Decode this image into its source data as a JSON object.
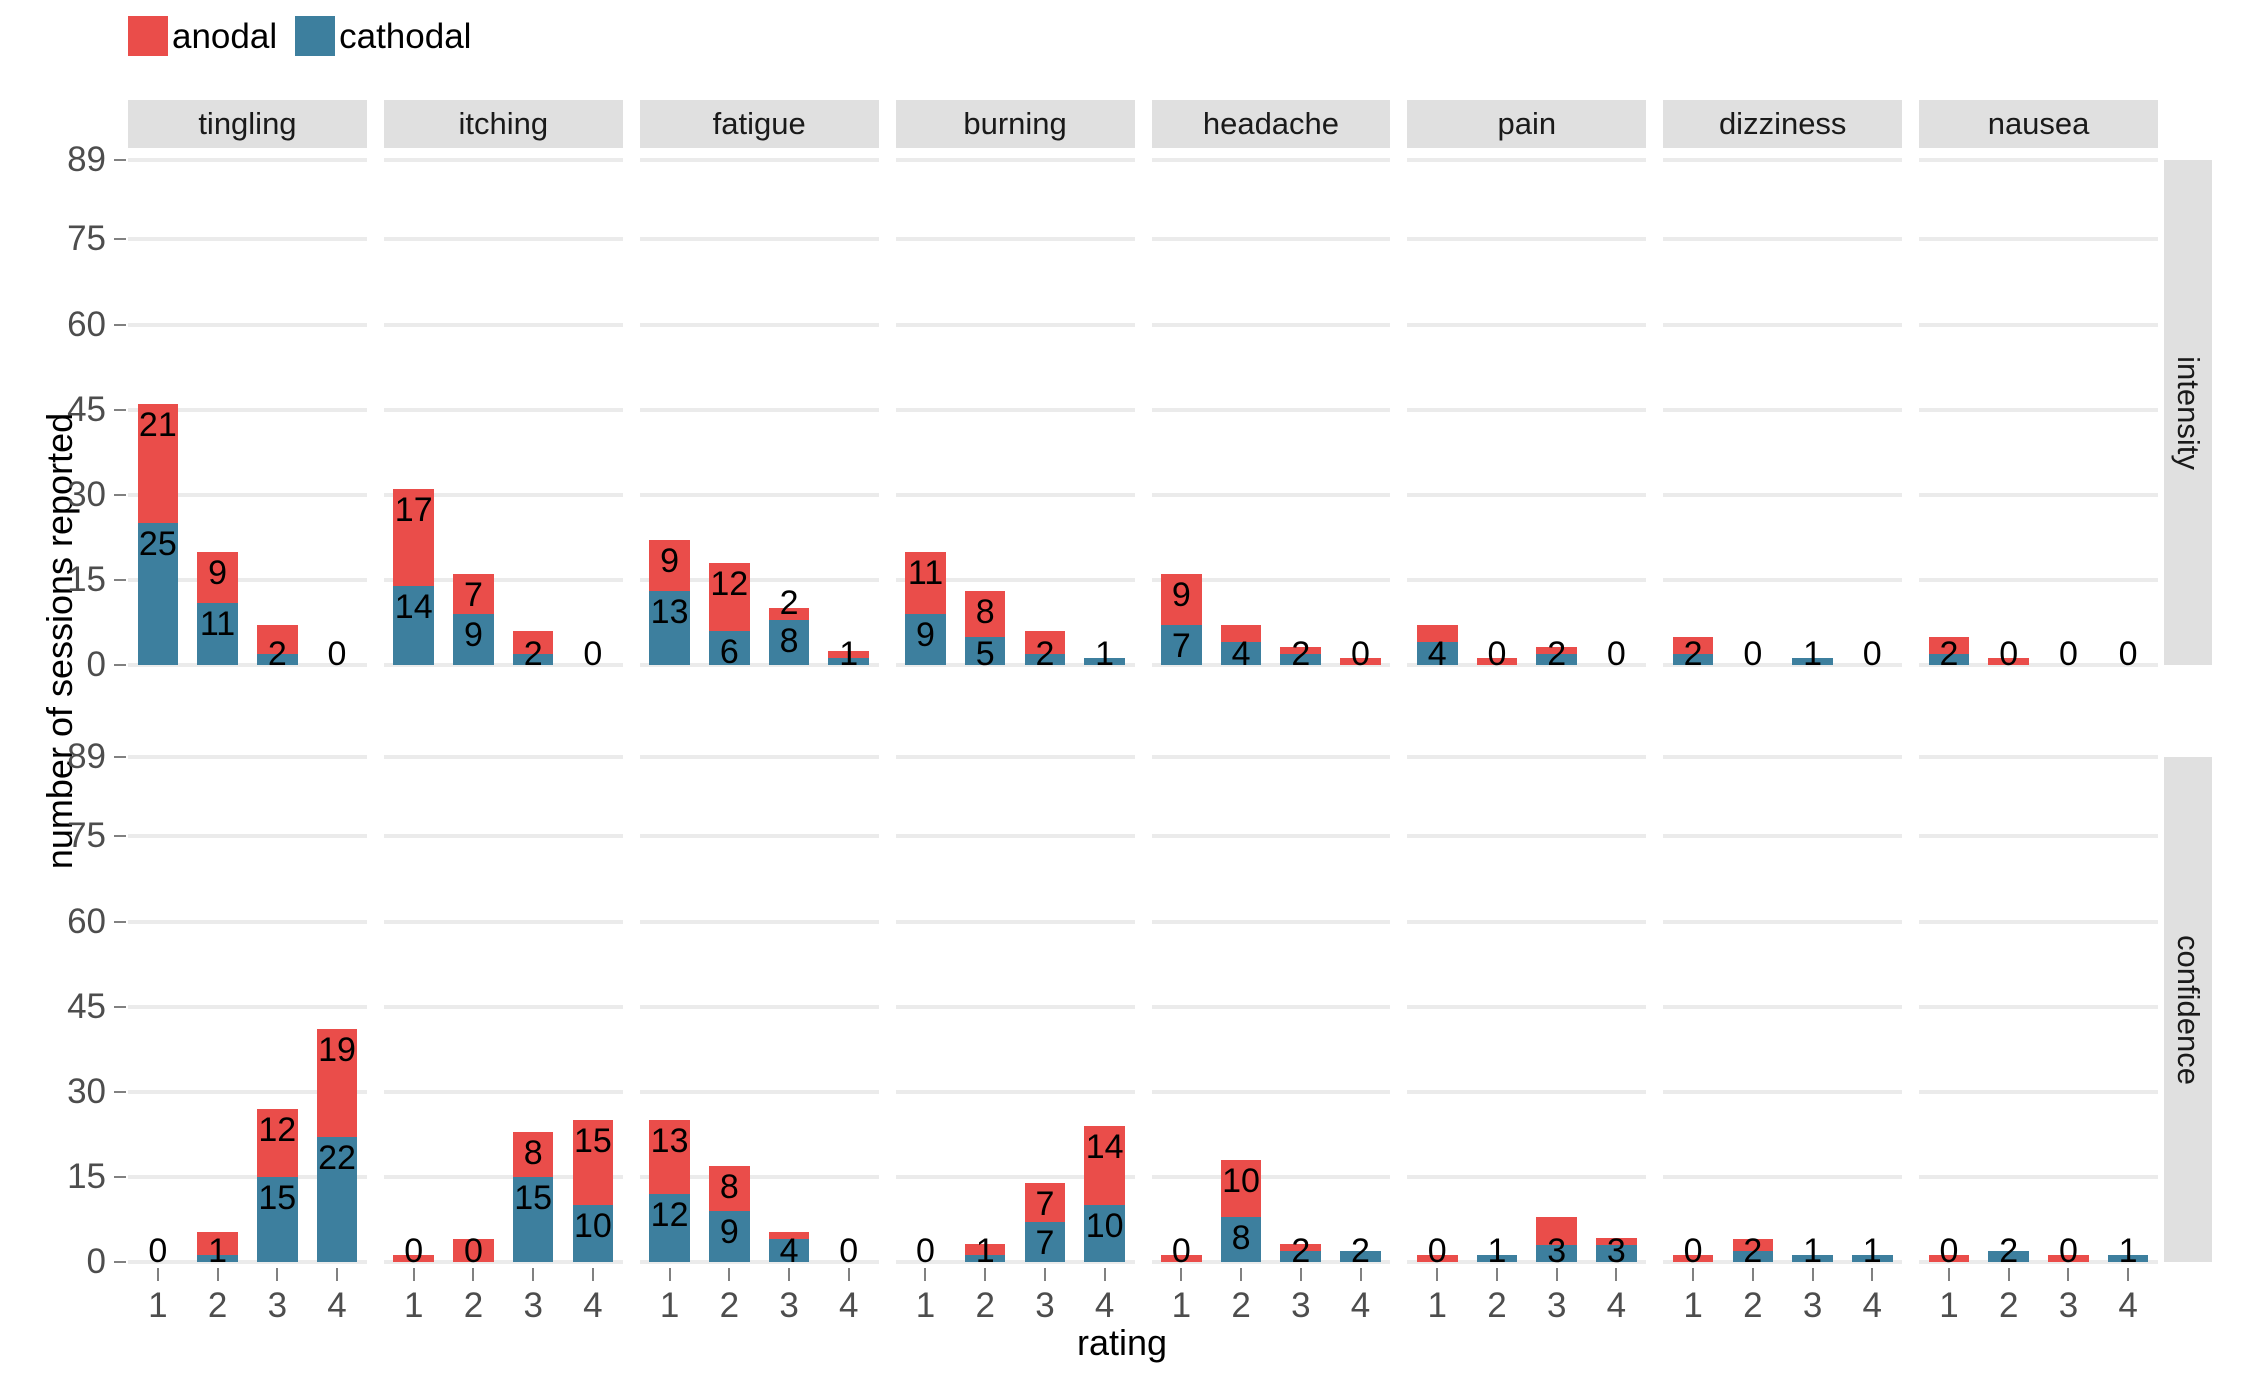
{
  "legend": {
    "items": [
      {
        "label": "anodal",
        "color": "#ea4d4a",
        "name": "legend-anodal"
      },
      {
        "label": "cathodal",
        "color": "#3d7f9e",
        "name": "legend-cathodal"
      }
    ]
  },
  "axes": {
    "ylabel": "number of sessions reported",
    "xlabel": "rating",
    "yticks": [
      "0",
      "15",
      "30",
      "45",
      "60",
      "75",
      "89"
    ],
    "ytick_values": [
      0,
      15,
      30,
      45,
      60,
      75,
      89
    ],
    "xticks": [
      "1",
      "2",
      "3",
      "4"
    ]
  },
  "facets": {
    "columns": [
      "tingling",
      "itching",
      "fatigue",
      "burning",
      "headache",
      "pain",
      "dizziness",
      "nausea"
    ],
    "rows": [
      "intensity",
      "confidence"
    ]
  },
  "colors": {
    "anodal": "#ea4d4a",
    "cathodal": "#3d7f9e",
    "strip": "#e0e0e0",
    "grid": "#ebebeb",
    "panel": "#ffffff",
    "axis_text": "#4d4d4d"
  },
  "chart_data": {
    "type": "bar",
    "title": "",
    "subtitle": "",
    "xlabel": "rating",
    "ylabel": "number of sessions reported",
    "ylim": [
      0,
      89
    ],
    "yticks": [
      0,
      15,
      30,
      45,
      60,
      75,
      89
    ],
    "grid": true,
    "legend_position": "top-left",
    "stacked": true,
    "categories": [
      "1",
      "2",
      "3",
      "4"
    ],
    "legend": [
      "anodal",
      "cathodal"
    ],
    "facet_columns": [
      "tingling",
      "itching",
      "fatigue",
      "burning",
      "headache",
      "pain",
      "dizziness",
      "nausea"
    ],
    "facet_rows": [
      "intensity",
      "confidence"
    ],
    "panels": [
      {
        "row": "intensity",
        "column": "tingling",
        "series": [
          {
            "name": "cathodal",
            "values": [
              25,
              11,
              2,
              0
            ],
            "labels": [
              "25",
              "11",
              "2",
              ""
            ]
          },
          {
            "name": "anodal",
            "values": [
              21,
              9,
              5,
              0
            ],
            "labels": [
              "21",
              "9",
              "",
              ""
            ]
          }
        ],
        "zero_labels": [
          "",
          "",
          "",
          "0"
        ]
      },
      {
        "row": "intensity",
        "column": "itching",
        "series": [
          {
            "name": "cathodal",
            "values": [
              14,
              9,
              2,
              0
            ],
            "labels": [
              "14",
              "9",
              "2",
              ""
            ]
          },
          {
            "name": "anodal",
            "values": [
              17,
              7,
              4,
              0
            ],
            "labels": [
              "17",
              "7",
              "",
              ""
            ]
          }
        ],
        "zero_labels": [
          "",
          "",
          "",
          "0"
        ]
      },
      {
        "row": "intensity",
        "column": "fatigue",
        "series": [
          {
            "name": "cathodal",
            "values": [
              13,
              6,
              8,
              1
            ],
            "labels": [
              "13",
              "6",
              "8",
              "1"
            ]
          },
          {
            "name": "anodal",
            "values": [
              9,
              12,
              2,
              1
            ],
            "labels": [
              "9",
              "12",
              "2",
              ""
            ]
          }
        ],
        "zero_labels": [
          "",
          "",
          "",
          ""
        ]
      },
      {
        "row": "intensity",
        "column": "burning",
        "series": [
          {
            "name": "cathodal",
            "values": [
              9,
              5,
              2,
              1
            ],
            "labels": [
              "9",
              "5",
              "2",
              "1"
            ]
          },
          {
            "name": "anodal",
            "values": [
              11,
              8,
              4,
              0
            ],
            "labels": [
              "11",
              "8",
              "",
              ""
            ]
          }
        ],
        "zero_labels": [
          "",
          "",
          "",
          ""
        ]
      },
      {
        "row": "intensity",
        "column": "headache",
        "series": [
          {
            "name": "cathodal",
            "values": [
              7,
              4,
              2,
              0
            ],
            "labels": [
              "7",
              "4",
              "2",
              ""
            ]
          },
          {
            "name": "anodal",
            "values": [
              9,
              3,
              1,
              1
            ],
            "labels": [
              "9",
              "",
              "",
              ""
            ]
          }
        ],
        "zero_labels": [
          "",
          "",
          "",
          "0"
        ]
      },
      {
        "row": "intensity",
        "column": "pain",
        "series": [
          {
            "name": "cathodal",
            "values": [
              4,
              0,
              2,
              0
            ],
            "labels": [
              "4",
              "",
              "2",
              ""
            ]
          },
          {
            "name": "anodal",
            "values": [
              3,
              1,
              1,
              0
            ],
            "labels": [
              "",
              "",
              "",
              ""
            ]
          }
        ],
        "zero_labels": [
          "",
          "0",
          "",
          "0"
        ]
      },
      {
        "row": "intensity",
        "column": "dizziness",
        "series": [
          {
            "name": "cathodal",
            "values": [
              2,
              0,
              1,
              0
            ],
            "labels": [
              "2",
              "",
              "1",
              ""
            ]
          },
          {
            "name": "anodal",
            "values": [
              3,
              0,
              0,
              0
            ],
            "labels": [
              "",
              "",
              "",
              ""
            ]
          }
        ],
        "zero_labels": [
          "",
          "0",
          "",
          "0"
        ]
      },
      {
        "row": "intensity",
        "column": "nausea",
        "series": [
          {
            "name": "cathodal",
            "values": [
              2,
              0,
              0,
              0
            ],
            "labels": [
              "2",
              "",
              "",
              ""
            ]
          },
          {
            "name": "anodal",
            "values": [
              3,
              1,
              0,
              0
            ],
            "labels": [
              "",
              "",
              "",
              ""
            ]
          }
        ],
        "zero_labels": [
          "",
          "0",
          "0",
          "0"
        ]
      },
      {
        "row": "confidence",
        "column": "tingling",
        "series": [
          {
            "name": "cathodal",
            "values": [
              0,
              1,
              15,
              22
            ],
            "labels": [
              "",
              "1",
              "15",
              "22"
            ]
          },
          {
            "name": "anodal",
            "values": [
              0,
              4,
              12,
              19
            ],
            "labels": [
              "",
              "",
              "12",
              "19"
            ]
          }
        ],
        "zero_labels": [
          "0",
          "",
          "",
          ""
        ]
      },
      {
        "row": "confidence",
        "column": "itching",
        "series": [
          {
            "name": "cathodal",
            "values": [
              0,
              0,
              15,
              10
            ],
            "labels": [
              "",
              "",
              "15",
              "10"
            ]
          },
          {
            "name": "anodal",
            "values": [
              1,
              4,
              8,
              15
            ],
            "labels": [
              "",
              "",
              "8",
              "15"
            ]
          }
        ],
        "zero_labels": [
          "0",
          "0",
          "",
          ""
        ]
      },
      {
        "row": "confidence",
        "column": "fatigue",
        "series": [
          {
            "name": "cathodal",
            "values": [
              12,
              9,
              4,
              0
            ],
            "labels": [
              "12",
              "9",
              "4",
              ""
            ]
          },
          {
            "name": "anodal",
            "values": [
              13,
              8,
              1,
              0
            ],
            "labels": [
              "13",
              "8",
              "",
              ""
            ]
          }
        ],
        "zero_labels": [
          "",
          "",
          "",
          "0"
        ]
      },
      {
        "row": "confidence",
        "column": "burning",
        "series": [
          {
            "name": "cathodal",
            "values": [
              0,
              1,
              7,
              10
            ],
            "labels": [
              "",
              "1",
              "7",
              "10"
            ]
          },
          {
            "name": "anodal",
            "values": [
              0,
              2,
              7,
              14
            ],
            "labels": [
              "",
              "",
              "7",
              "14"
            ]
          }
        ],
        "zero_labels": [
          "0",
          "",
          "",
          ""
        ]
      },
      {
        "row": "confidence",
        "column": "headache",
        "series": [
          {
            "name": "cathodal",
            "values": [
              0,
              8,
              2,
              2
            ],
            "labels": [
              "",
              "8",
              "2",
              "2"
            ]
          },
          {
            "name": "anodal",
            "values": [
              1,
              10,
              1,
              0
            ],
            "labels": [
              "",
              "10",
              "",
              ""
            ]
          }
        ],
        "zero_labels": [
          "0",
          "",
          "",
          ""
        ]
      },
      {
        "row": "confidence",
        "column": "pain",
        "series": [
          {
            "name": "cathodal",
            "values": [
              0,
              1,
              3,
              3
            ],
            "labels": [
              "",
              "1",
              "3",
              "3"
            ]
          },
          {
            "name": "anodal",
            "values": [
              1,
              0,
              5,
              1
            ],
            "labels": [
              "",
              "",
              "",
              ""
            ]
          }
        ],
        "zero_labels": [
          "0",
          "",
          "",
          ""
        ]
      },
      {
        "row": "confidence",
        "column": "dizziness",
        "series": [
          {
            "name": "cathodal",
            "values": [
              0,
              2,
              1,
              1
            ],
            "labels": [
              "",
              "2",
              "1",
              "1"
            ]
          },
          {
            "name": "anodal",
            "values": [
              1,
              2,
              0,
              0
            ],
            "labels": [
              "",
              "",
              "",
              ""
            ]
          }
        ],
        "zero_labels": [
          "0",
          "",
          "",
          ""
        ]
      },
      {
        "row": "confidence",
        "column": "nausea",
        "series": [
          {
            "name": "cathodal",
            "values": [
              0,
              2,
              0,
              1
            ],
            "labels": [
              "",
              "2",
              "",
              "1"
            ]
          },
          {
            "name": "anodal",
            "values": [
              1,
              0,
              1,
              0
            ],
            "labels": [
              "",
              "",
              "",
              ""
            ]
          }
        ],
        "zero_labels": [
          "0",
          "",
          "0",
          ""
        ]
      }
    ]
  }
}
